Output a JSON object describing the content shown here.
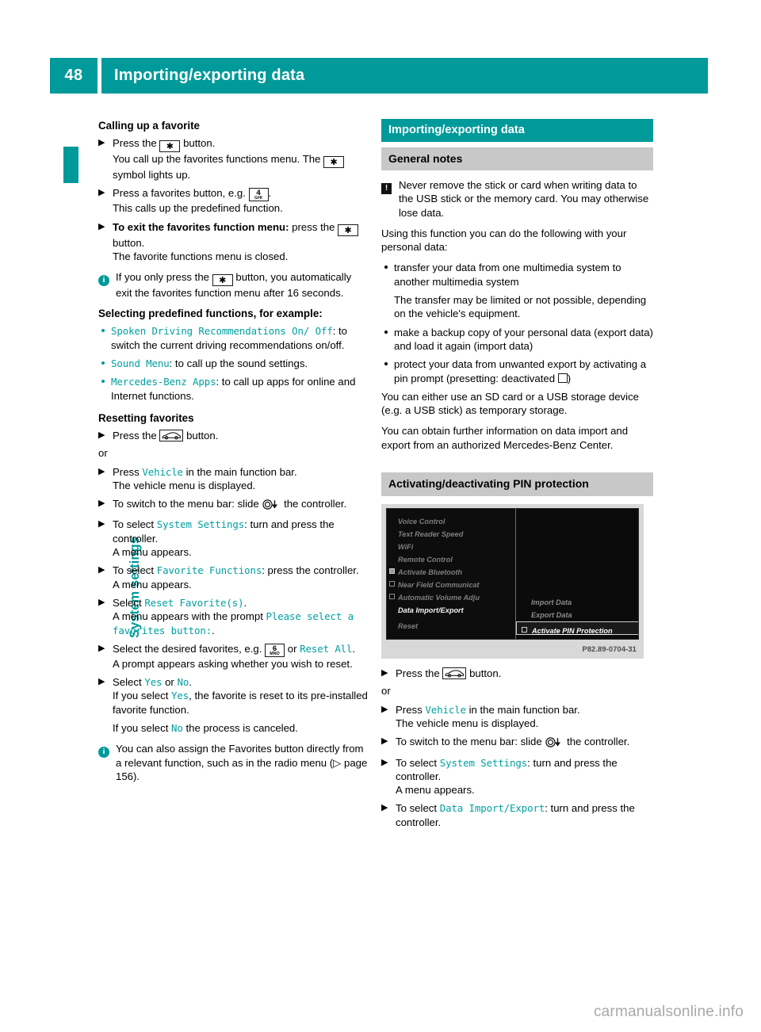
{
  "header": {
    "page_number": "48",
    "title": "Importing/exporting data",
    "accent_color": "#009a9a"
  },
  "chapter_tab": {
    "label": "System settings"
  },
  "left_column": {
    "heading_1": "Calling up a favorite",
    "step_1_a": "Press the",
    "step_1_key": "★",
    "step_1_b": "button.",
    "step_1_sub_a": "You call up the favorites functions menu. The",
    "step_1_sub_b": "symbol lights up.",
    "step_2_a": "Press a favorites button, e.g.",
    "step_2_key_num": "4",
    "step_2_key_letters": "GHI",
    "step_2_b": ".",
    "step_2_sub": "This calls up the predefined function.",
    "step_3_bold": "To exit the favorites function menu:",
    "step_3_a": "press the",
    "step_3_b": "button.",
    "step_3_sub": "The favorite functions menu is closed.",
    "note_1_a": "If you only press the",
    "note_1_b": "button, you automatically exit the favorites function menu after 16 seconds.",
    "heading_2": "Selecting predefined functions, for example:",
    "bullets": [
      {
        "ui": "Spoken Driving Recommendations On/ Off",
        "text": ": to switch the current driving recommendations on/off."
      },
      {
        "ui": "Sound Menu",
        "text": ": to call up the sound settings."
      },
      {
        "ui": "Mercedes-Benz Apps",
        "text": ": to call up apps for online and Internet functions."
      }
    ],
    "heading_3": "Resetting favorites",
    "step_4_a": "Press the",
    "step_4_b": "button.",
    "or_1": "or",
    "step_5_a": "Press",
    "step_5_ui": "Vehicle",
    "step_5_b": "in the main function bar.",
    "step_5_sub": "The vehicle menu is displayed.",
    "step_6_a": "To switch to the menu bar: slide",
    "step_6_b": "the controller.",
    "step_7_a": "To select",
    "step_7_ui": "System Settings",
    "step_7_b": ": turn and press the controller.",
    "step_7_sub": "A menu appears.",
    "step_8_a": "To select",
    "step_8_ui": "Favorite Functions",
    "step_8_b": ": press the controller.",
    "step_8_sub": "A menu appears.",
    "step_9_a": "Select",
    "step_9_ui": "Reset Favorite(s)",
    "step_9_b": ".",
    "step_9_sub_a": "A menu appears with the prompt",
    "step_9_sub_ui": "Please select a favorites button:",
    "step_9_sub_b": ".",
    "step_10_a": "Select the desired favorites, e.g.",
    "step_10_key_num": "6",
    "step_10_key_letters": "MNO",
    "step_10_b": "or",
    "step_10_ui": "Reset All",
    "step_10_c": ".",
    "step_10_sub": "A prompt appears asking whether you wish to reset.",
    "step_11_a": "Select",
    "step_11_ui_yes": "Yes",
    "step_11_or": "or",
    "step_11_ui_no": "No",
    "step_11_b": ".",
    "step_11_sub_a": "If you select",
    "step_11_sub_ui": "Yes",
    "step_11_sub_b": ", the favorite is reset to its pre-installed favorite function.",
    "step_11_sub2_a": "If you select",
    "step_11_sub2_ui": "No",
    "step_11_sub2_b": "the process is canceled.",
    "note_2": "You can also assign the Favorites button directly from a relevant function, such as in the radio menu (",
    "note_2_page_ref": "page 156",
    "note_2_end": ")."
  },
  "right_column": {
    "section_title": "Importing/exporting data",
    "subsection_title": "General notes",
    "warning_text": "Never remove the stick or card when writing data to the USB stick or the memory card. You may otherwise lose data.",
    "intro": "Using this function you can do the following with your personal data:",
    "bullets": [
      "transfer your data from one multimedia system to another multimedia system",
      "make a backup copy of your personal data (export data) and load it again (import data)",
      "protect your data from unwanted export by activating a pin prompt (presetting: deactivated"
    ],
    "bullet_1_sub": "The transfer may be limited or not possible, depending on the vehicle's equipment.",
    "bullet_3_end": ")",
    "para_1": "You can either use an SD card or a USB storage device (e.g. a USB stick) as temporary storage.",
    "para_2": "You can obtain further information on data import and export from an authorized Mercedes-Benz Center.",
    "pin_section_title": "Activating/deactivating PIN protection",
    "figure": {
      "caption_code": "P82.89-0704-31",
      "left_menu": [
        {
          "label": "Voice Control",
          "checkbox": "none",
          "bright": false
        },
        {
          "label": "Text Reader Speed",
          "checkbox": "none",
          "bright": false
        },
        {
          "label": "WiFi",
          "checkbox": "none",
          "bright": false
        },
        {
          "label": "Remote Control",
          "checkbox": "none",
          "bright": false
        },
        {
          "label": "Activate Bluetooth",
          "checkbox": "checked",
          "bright": false
        },
        {
          "label": "Near Field Communicat",
          "checkbox": "unchecked",
          "bright": false
        },
        {
          "label": "Automatic Volume Adju",
          "checkbox": "unchecked",
          "bright": false
        },
        {
          "label": "Data Import/Export",
          "checkbox": "none",
          "bright": true
        },
        {
          "label": "Reset",
          "checkbox": "none",
          "bright": false
        }
      ],
      "right_menu": [
        "Import Data",
        "Export Data"
      ],
      "highlighted_item": "Activate PIN Protection"
    },
    "step_1_a": "Press the",
    "step_1_b": "button.",
    "or_1": "or",
    "step_2_a": "Press",
    "step_2_ui": "Vehicle",
    "step_2_b": "in the main function bar.",
    "step_2_sub": "The vehicle menu is displayed.",
    "step_3_a": "To switch to the menu bar: slide",
    "step_3_b": "the controller.",
    "step_4_a": "To select",
    "step_4_ui": "System Settings",
    "step_4_b": ": turn and press the controller.",
    "step_4_sub": "A menu appears.",
    "step_5_a": "To select",
    "step_5_ui": "Data Import/Export",
    "step_5_b": ": turn and press the controller."
  },
  "footer": {
    "watermark": "carmanualsonline.info"
  }
}
